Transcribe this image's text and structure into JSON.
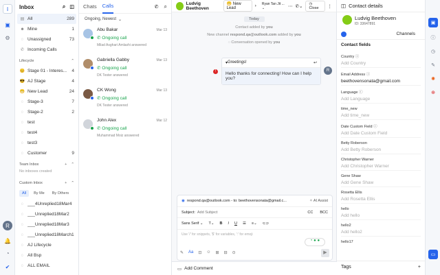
{
  "inbox": {
    "title": "Inbox",
    "items": [
      {
        "label": "All",
        "count": "289"
      },
      {
        "label": "Mine",
        "count": "1"
      },
      {
        "label": "Unassigned",
        "count": "73"
      },
      {
        "label": "Incoming Calls",
        "count": ""
      }
    ],
    "lifecycle_title": "Lifecycle",
    "lifecycle": [
      {
        "icon": "😊",
        "label": "Stage 01 - Interes...",
        "count": "4"
      },
      {
        "icon": "😎",
        "label": "AJ Stage",
        "count": "4"
      },
      {
        "icon": "😁",
        "label": "New Lead",
        "count": "24"
      },
      {
        "icon": "◌",
        "label": "Stage-3",
        "count": "7"
      },
      {
        "icon": "◌",
        "label": "Stage-2",
        "count": "2"
      },
      {
        "icon": "◌",
        "label": "test",
        "count": ""
      },
      {
        "icon": "◌",
        "label": "test4",
        "count": ""
      },
      {
        "icon": "◌",
        "label": "test3",
        "count": ""
      },
      {
        "icon": "◌",
        "label": "Customer",
        "count": "9"
      }
    ],
    "team_title": "Team Inbox",
    "team_note": "No inboxes created",
    "custom_title": "Custom Inbox",
    "filters": [
      "All",
      "By Me",
      "By Others"
    ],
    "custom": [
      "___4Unreplied18Mar4",
      "___Unreplied18Mar2",
      "___Unreplied18Mar3",
      "___Unreplied18March1",
      "AJ Lifecycle",
      "All Bsp",
      "ALL EMAIL"
    ]
  },
  "list": {
    "tab_chats": "Chats",
    "tab_calls": "Calls",
    "sort": "Ongoing, Newest",
    "items": [
      {
        "name": "Abu Bakar",
        "date": "Mar 13",
        "status": "Ongoing call",
        "sub": "Milad Asghari Amlashi answered",
        "dot": "#16a34a"
      },
      {
        "name": "Gabriella Gabby",
        "date": "Mar 13",
        "status": "Ongoing call",
        "sub": "DK Tester answered",
        "dot": "#2563eb"
      },
      {
        "name": "CK Wong",
        "date": "Mar 13",
        "status": "Ongoing call",
        "sub": "DK Tester answered",
        "dot": "#2563eb"
      },
      {
        "name": "John Alex",
        "date": "Mar 12",
        "status": "Ongoing call",
        "sub": "Muhammad Moiz answered",
        "dot": "#16a34a"
      }
    ]
  },
  "chat": {
    "contact": "Ludvig Beethoven",
    "lifecycle": "New Lead",
    "assignee": "Ryan Tan Jit ...",
    "close": "Close",
    "today": "Today",
    "sys1_pre": "Contact added by ",
    "sys1_b": "you",
    "sys2_pre": "New channel ",
    "sys2_b": "respond.qa@outlook.com",
    "sys2_mid": " added by ",
    "sys2_b2": "you",
    "sys3_pre": "Conversation opened by ",
    "sys3_b": "you",
    "msg_title": "Greetings!",
    "msg_body": "Hello thanks for connecting! How can I help you?",
    "composer": {
      "from": "respond.qa@outlook.com - to: beethovensonata@gmail.c...",
      "ai": "AI Assist",
      "subject_label": "Subject:",
      "subject_placeholder": "Add Subject",
      "cc": "CC",
      "bcc": "BCC",
      "font": "Sans Serif",
      "hint": "Use '/' for snippets, '$' for variables, ':' for emoji"
    },
    "add_comment": "Add Comment"
  },
  "details": {
    "title": "Contact details",
    "name": "Ludvig Beethoven",
    "id": "ID: 33647891",
    "channels": "Channels",
    "fields_title": "Contact fields",
    "fields": [
      {
        "label": "Country",
        "value": "Add Country",
        "filled": false
      },
      {
        "label": "Email Address",
        "value": "beethovensonata@gmail.com",
        "filled": true
      },
      {
        "label": "Language",
        "value": "Add Language",
        "filled": false
      },
      {
        "label": "time_new",
        "value": "Add time_new",
        "filled": false
      },
      {
        "label": "Date Custom Field",
        "value": "Add Date Custom Field",
        "filled": false
      },
      {
        "label": "Betty Roberson",
        "value": "Add Betty Roberson",
        "filled": false
      },
      {
        "label": "Christopher Warner",
        "value": "Add Christopher Warner",
        "filled": false
      },
      {
        "label": "Gene Shaw",
        "value": "Add Gene Shaw",
        "filled": false
      },
      {
        "label": "Rosetta Ellis",
        "value": "Add Rosetta Ellis",
        "filled": false
      },
      {
        "label": "hello",
        "value": "Add hello",
        "filled": false
      },
      {
        "label": "hello2",
        "value": "Add hello2",
        "filled": false
      },
      {
        "label": "hello17",
        "value": "",
        "filled": false
      }
    ],
    "tags": "Tags"
  },
  "user_initial": "R",
  "colors": {
    "accent": "#2563eb",
    "green": "#16a34a",
    "brand": "#2563eb"
  }
}
